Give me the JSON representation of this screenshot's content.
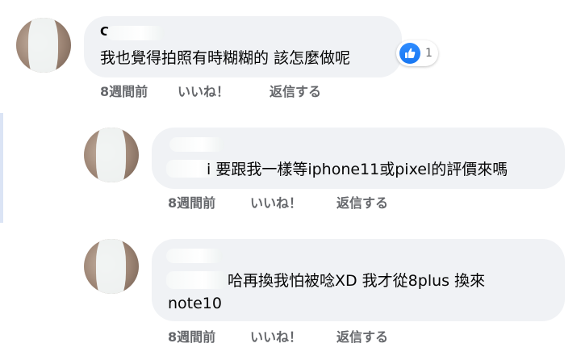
{
  "comments": [
    {
      "name": "C",
      "text": "我也覺得拍照有時糊糊的 該怎麼做呢",
      "time": "8週間前",
      "like_label": "いいね！",
      "reply_label": "返信する",
      "reaction_count": "1"
    },
    {
      "name": "",
      "text": "i 要跟我一樣等iphone11或pixel的評價來嗎",
      "time": "8週間前",
      "like_label": "いいね！",
      "reply_label": "返信する"
    },
    {
      "name": "",
      "text_line1": "哈再換我怕被唸XD  我才從8plus 換來",
      "text_line2": "note10",
      "time": "8週間前",
      "like_label": "いいね！",
      "reply_label": "返信する"
    }
  ],
  "icons": {
    "reaction": "thumbs-up-icon"
  },
  "colors": {
    "bubble": "#f0f2f5",
    "meta_text": "#65676b",
    "like_blue": "#1877f2",
    "thread_line": "#dbe4f5"
  }
}
